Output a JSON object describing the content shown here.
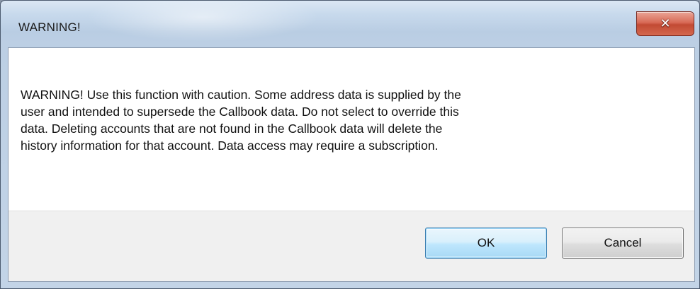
{
  "dialog": {
    "title": "WARNING!",
    "close_icon": "close-icon",
    "message": "WARNING!  Use this function with caution.  Some address data is supplied by the\nuser and intended to supersede the Callbook data.  Do not select to override this\ndata.  Deleting accounts that are not found in the Callbook data will delete the\nhistory information for that account.   Data access may require a subscription.",
    "buttons": {
      "ok_label": "OK",
      "cancel_label": "Cancel"
    }
  },
  "colors": {
    "close_button": "#c24a33",
    "ok_button_border": "#3c7fb1",
    "message_background": "#ffffff"
  }
}
